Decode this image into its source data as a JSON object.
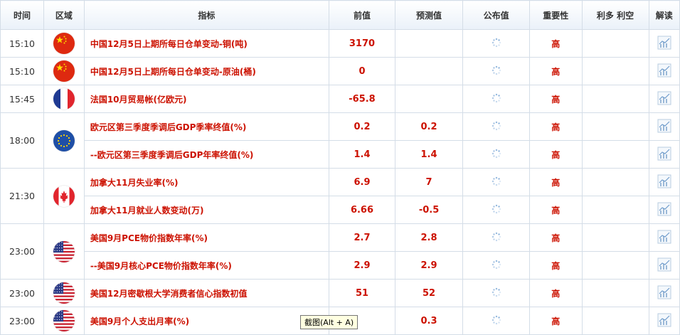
{
  "header": {
    "time": "时间",
    "region": "区域",
    "indicator": "指标",
    "previous": "前值",
    "forecast": "预测值",
    "actual": "公布值",
    "importance": "重要性",
    "impact": "利多 利空",
    "analysis": "解读"
  },
  "rows": [
    {
      "time": "15:10",
      "country": "china",
      "indicator": "中国12月5日上期所每日仓单变动-铜(吨)",
      "previous": "3170",
      "forecast": "",
      "importance": "高"
    },
    {
      "time": "15:10",
      "country": "china",
      "indicator": "中国12月5日上期所每日仓单变动-原油(桶)",
      "previous": "0",
      "forecast": "",
      "importance": "高"
    },
    {
      "time": "15:45",
      "country": "france",
      "indicator": "法国10月贸易帐(亿欧元)",
      "previous": "-65.8",
      "forecast": "",
      "importance": "高"
    },
    {
      "time": "18:00",
      "country": "eu",
      "indicator": "欧元区第三季度季调后GDP季率终值(%)",
      "previous": "0.2",
      "forecast": "0.2",
      "importance": "高"
    },
    {
      "time": "",
      "country": "",
      "indicator": "--欧元区第三季度季调后GDP年率终值(%)",
      "previous": "1.4",
      "forecast": "1.4",
      "importance": "高"
    },
    {
      "time": "21:30",
      "country": "canada",
      "indicator": "加拿大11月失业率(%)",
      "previous": "6.9",
      "forecast": "7",
      "importance": "高"
    },
    {
      "time": "",
      "country": "",
      "indicator": "加拿大11月就业人数变动(万)",
      "previous": "6.66",
      "forecast": "-0.5",
      "importance": "高"
    },
    {
      "time": "23:00",
      "country": "usa",
      "indicator": "美国9月PCE物价指数年率(%)",
      "previous": "2.7",
      "forecast": "2.8",
      "importance": "高"
    },
    {
      "time": "",
      "country": "",
      "indicator": "--美国9月核心PCE物价指数年率(%)",
      "previous": "2.9",
      "forecast": "2.9",
      "importance": "高"
    },
    {
      "time": "23:00",
      "country": "usa",
      "indicator": "美国12月密歇根大学消费者信心指数初值",
      "previous": "51",
      "forecast": "52",
      "importance": "高"
    },
    {
      "time": "23:00",
      "country": "usa",
      "indicator": "美国9月个人支出月率(%)",
      "previous": "",
      "forecast": "0.3",
      "importance": "高"
    }
  ],
  "tooltip": "截图(Alt + A)",
  "colors": {
    "accent_red": "#cc1100",
    "border": "#d4dde7",
    "header_bg": "#eaf1f9"
  }
}
